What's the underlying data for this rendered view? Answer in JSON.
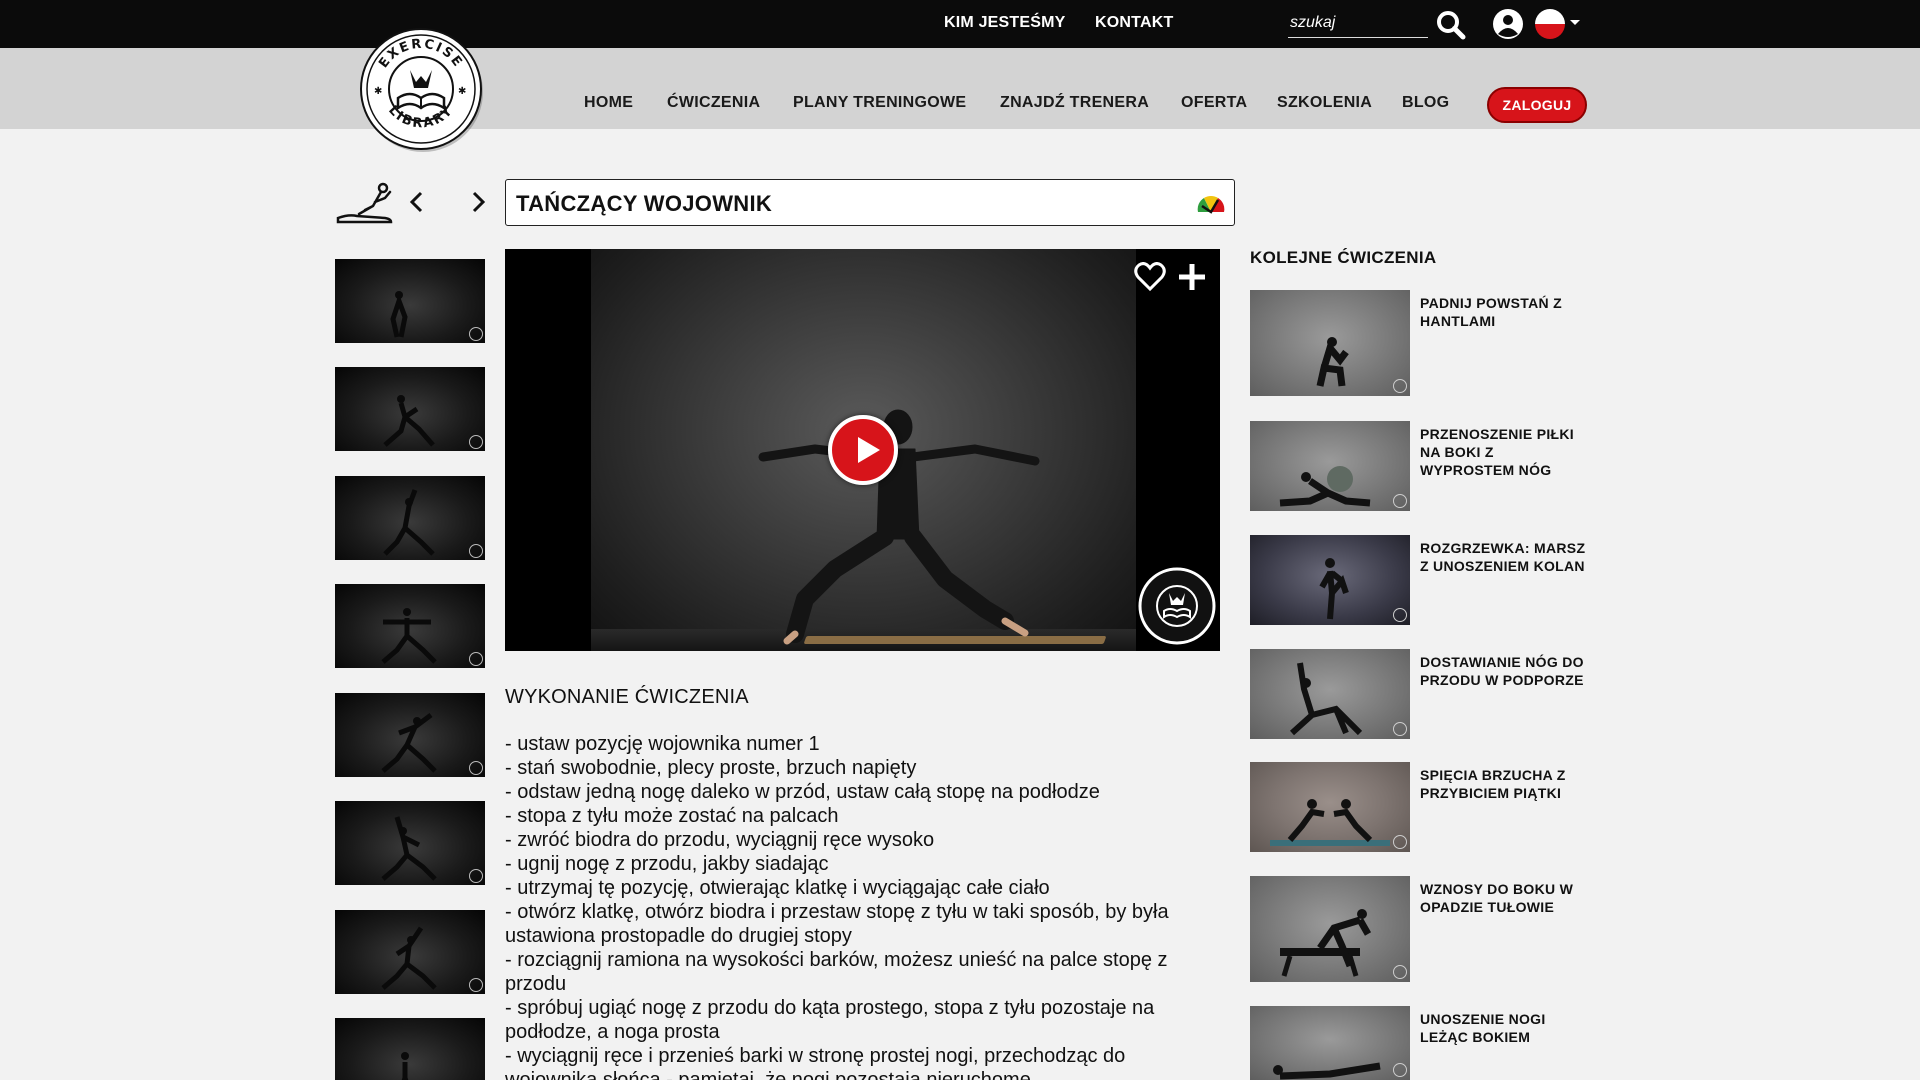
{
  "topbar": {
    "links": [
      "KIM JESTEŚMY",
      "KONTAKT"
    ],
    "search_placeholder": "szukaj"
  },
  "nav": {
    "items": [
      "HOME",
      "ĆWICZENIA",
      "PLANY TRENINGOWE",
      "ZNAJDŹ TRENERA",
      "OFERTA",
      "SZKOLENIA",
      "BLOG"
    ],
    "login_label": "ZALOGUJ"
  },
  "logo": {
    "top_text": "EXERCISE",
    "bottom_text": "LIBRARY"
  },
  "exercise": {
    "title": "TAŃCZĄCY WOJOWNIK"
  },
  "description": {
    "heading": "WYKONANIE ĆWICZENIA",
    "steps": [
      "- ustaw pozycję wojownika numer 1",
      "- stań swobodnie, plecy proste, brzuch napięty",
      "- odstaw jedną nogę daleko w przód, ustaw całą stopę na podłodze",
      "- stopa z tyłu może zostać na palcach",
      "- zwróć biodra do przodu, wyciągnij ręce wysoko",
      "- ugnij nogę z przodu, jakby siadając",
      "- utrzymaj tę pozycję, otwierając klatkę i wyciągając całe ciało",
      "- otwórz klatkę, otwórz biodra i przestaw stopę z tyłu w taki sposób, by była ustawiona prostopadle do drugiej stopy",
      "- rozciągnij ramiona na wysokości barków, możesz unieść na palce stopę z przodu",
      "- spróbuj ugiąć nogę z przodu do kąta prostego, stopa z tyłu pozostaje na podłodze, a noga prosta",
      "- wyciągnij ręce i przenieś barki w stronę prostej nogi, przechodząc do wojownika słońca - pamiętaj, że nogi pozostają nieruchome"
    ]
  },
  "sidebar": {
    "heading": "KOLEJNE ĆWICZENIA",
    "items": [
      "PADNIJ POWSTAŃ Z HANTLAMI",
      "PRZENOSZENIE PIŁKI NA BOKI Z WYPROSTEM NÓG",
      "ROZGRZEWKA: MARSZ Z UNOSZENIEM KOLAN",
      "DOSTAWIANIE NÓG DO PRZODU W PODPORZE",
      "SPIĘCIA BRZUCHA Z PRZYBICIEM PIĄTKI",
      "WZNOSY DO BOKU W OPADZIE TUŁOWIE",
      "UNOSZENIE NOGI LEŻĄC BOKIEM"
    ]
  },
  "colors": {
    "accent_red": "#d7141a",
    "topbar_bg": "#0b0b0b",
    "navbar_bg": "#d3d3d3",
    "page_bg": "#f2f2f2"
  },
  "icons": [
    "search-icon",
    "user-icon",
    "flag-pl-icon",
    "chevron-down-icon",
    "exercise-type-icon",
    "prev-arrow-icon",
    "next-arrow-icon",
    "level-icon",
    "heart-icon",
    "plus-icon",
    "play-icon"
  ]
}
